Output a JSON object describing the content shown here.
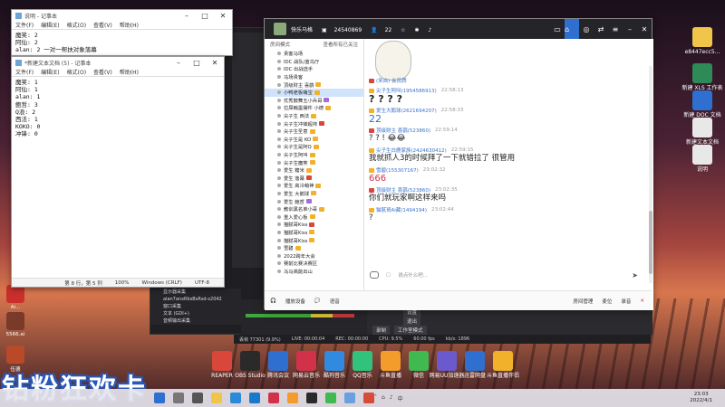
{
  "notepad1": {
    "title": "说明 - 记事本",
    "menu": [
      "文件(F)",
      "编辑(E)",
      "格式(O)",
      "查看(V)",
      "帮助(H)"
    ],
    "lines": [
      "魔笑: 2",
      "阿仙: 2",
      "alan: 2   一对一帮扶对象落幕"
    ]
  },
  "notepad2": {
    "title": "*新建文本文档 (5) - 记事本",
    "menu": [
      "文件(F)",
      "编辑(E)",
      "格式(O)",
      "查看(V)",
      "帮助(H)"
    ],
    "lines": [
      "魔笑: 1",
      "阿仙: 1",
      "alan: 1",
      "鲍哲: 3",
      "Q浪: 2",
      "西法: 1",
      "KOKO: 0",
      "冲锋: 0"
    ],
    "status": {
      "position": "第 8 行，第 5 列",
      "zoom": "100%",
      "line_ending": "Windows (CRLF)",
      "encoding": "UTF-8"
    }
  },
  "douyu": {
    "header": {
      "room_name": "快乐马格",
      "room_id": "24540869",
      "viewers": "22"
    },
    "sidebar": {
      "mode_label": "房间模式",
      "switch_label": "查看所有已关注",
      "items": [
        {
          "label": "贵客马场",
          "badge": "",
          "sel": false
        },
        {
          "label": "IDC 战队/蓝鸟厅",
          "badge": "",
          "sel": false
        },
        {
          "label": "IDC 出战选手",
          "badge": "",
          "sel": false
        },
        {
          "label": "马场贵客",
          "badge": "",
          "sel": false
        },
        {
          "label": "顶级财主 喜鹊",
          "badge": "y",
          "sel": false
        },
        {
          "label": "小鸭老板萌宝",
          "badge": "y",
          "sel": true
        },
        {
          "label": "优秀鼓舞五小兵哥",
          "badge": "p",
          "sel": false
        },
        {
          "label": "拉屎翰墨摆件 小德",
          "badge": "y",
          "sel": false
        },
        {
          "label": "尖子生 西法",
          "badge": "y",
          "sel": false
        },
        {
          "label": "尖子生冲锋超帅",
          "badge": "r",
          "sel": false
        },
        {
          "label": "尖子生圣意",
          "badge": "y",
          "sel": false
        },
        {
          "label": "尖子生是 KO",
          "badge": "y",
          "sel": false
        },
        {
          "label": "尖子生是阿Q",
          "badge": "y",
          "sel": false
        },
        {
          "label": "尖子生阿叫",
          "badge": "y",
          "sel": false
        },
        {
          "label": "尖子生魔笑",
          "badge": "y",
          "sel": false
        },
        {
          "label": "爱生 糖米",
          "badge": "y",
          "sel": false
        },
        {
          "label": "爱生 落幕",
          "badge": "r",
          "sel": false
        },
        {
          "label": "爱生 高冷萌神",
          "badge": "y",
          "sel": false
        },
        {
          "label": "爱生 大鹅球",
          "badge": "y",
          "sel": false
        },
        {
          "label": "爱生 鲍哲",
          "badge": "p",
          "sel": false
        },
        {
          "label": "教训黑名单小哥",
          "badge": "y",
          "sel": false
        },
        {
          "label": "重入爱心板",
          "badge": "y",
          "sel": false
        },
        {
          "label": "猫腻哥Kiss",
          "badge": "r",
          "sel": false
        },
        {
          "label": "猫腻哥Kiss",
          "badge": "y",
          "sel": false
        },
        {
          "label": "猫腻哥Kiss",
          "badge": "y",
          "sel": false
        },
        {
          "label": "雪碧",
          "badge": "y",
          "sel": false
        },
        {
          "label": "2022跨年大会",
          "badge": "",
          "sel": false
        },
        {
          "label": "赛前比赛决赛区",
          "badge": "",
          "sel": false
        },
        {
          "label": "马马高能出山",
          "badge": "",
          "sel": false
        }
      ]
    },
    "messages": [
      {
        "user": "(来自) 会员牌",
        "time": "",
        "text": "",
        "style": "normal"
      },
      {
        "user": "尖子生阿叫(1954586913)",
        "time": "22:58:13",
        "text": "? ? ? ?",
        "style": "big"
      },
      {
        "user": "爱生大鹅球(2621694207)",
        "time": "22:58:33",
        "text": "22",
        "style": "blue"
      },
      {
        "user": "顶级财主 喜鹊(523860)",
        "time": "22:59:14",
        "text": "? ? ! 😂😂",
        "style": "normal"
      },
      {
        "user": "尖子生白鹿家族(2424630412)",
        "time": "22:59:15",
        "text": "我就抓人3的时候拜了一下就错拉了  很管用",
        "style": "normal"
      },
      {
        "user": "雪碧(155307167)",
        "time": "23:02:32",
        "text": "666",
        "style": "red"
      },
      {
        "user": "顶级财主 喜鹊(523860)",
        "time": "23:02:35",
        "text": "你们就玩家啊这样来吗",
        "style": "normal"
      },
      {
        "user": "猫腻哥Ai藏(1494194)",
        "time": "23:02:44",
        "text": "?",
        "style": "normal"
      }
    ],
    "input_placeholder": "说点什么吧...",
    "bottom": {
      "voice": "播放设备",
      "talk": "语音",
      "room_settings": "房间管理",
      "mic": "麦位",
      "record": "录音"
    }
  },
  "obs": {
    "sources": [
      "显示器采集",
      "alan7anxRbsBsRsd-s2042",
      "窗口采集",
      "文本 (GDI+)",
      "音频输出采集"
    ],
    "status": [
      "丢帧 77301 (9.9%)",
      "LIVE: 00:00:04",
      "REC: 00:00:00",
      "CPU: 9.5%",
      "60.00 fps",
      "kb/s: 1896"
    ],
    "dock_buttons": [
      "录制",
      "工作室模式",
      "设置",
      "退出"
    ]
  },
  "desktop_icons_right": [
    {
      "label": "e8447ecc5...",
      "icon": "folder"
    },
    {
      "label": "新建 XLS 工作表",
      "icon": "sheet"
    },
    {
      "label": "新建 DOC 文档",
      "icon": "doc"
    },
    {
      "label": "新建文本文档 (5)",
      "icon": "txt"
    },
    {
      "label": "说明",
      "icon": "txt"
    }
  ],
  "dock_icons": [
    {
      "label": "REAPER",
      "color": "#d9473b"
    },
    {
      "label": "OBS Studio",
      "color": "#2a2a2a"
    },
    {
      "label": "腾讯会议",
      "color": "#2f6fcf"
    },
    {
      "label": "网易云音乐",
      "color": "#d1324a"
    },
    {
      "label": "酷狗音乐",
      "color": "#2f8ae0"
    },
    {
      "label": "QQ音乐",
      "color": "#31c27c"
    },
    {
      "label": "斗鱼直播",
      "color": "#f39c2b"
    },
    {
      "label": "微信",
      "color": "#3fb950"
    },
    {
      "label": "网易UU加速器",
      "color": "#6a5acd"
    },
    {
      "label": "迅雷网盘",
      "color": "#2f6fcf"
    },
    {
      "label": "斗鱼直播伴侣",
      "color": "#f1b12a"
    }
  ],
  "taskbar": {
    "time": "23:03",
    "date": "2022/4/1"
  },
  "promo_text": "钻粉狂欢卡"
}
